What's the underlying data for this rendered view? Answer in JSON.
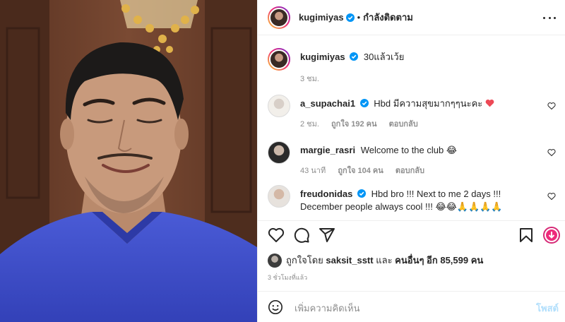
{
  "post": {
    "author": "kugimiyas",
    "follow_status": "กำลังติดตาม",
    "caption": "30แล้วเว้ย",
    "caption_time": "3 ชม."
  },
  "comments": [
    {
      "user": "a_supachai1",
      "text": "Hbd มีความสุขมากๆๆนะคะ",
      "time": "2 ชม.",
      "likes": "ถูกใจ 192 คน",
      "reply": "ตอบกลับ"
    },
    {
      "user": "margie_rasri",
      "text": "Welcome to the club 😂",
      "time": "43 นาที",
      "likes": "ถูกใจ 104 คน",
      "reply": "ตอบกลับ"
    },
    {
      "user": "freudonidas",
      "text": "Hbd bro !!! Next to me 2 days !!! December people always cool !!! 😂😂🙏🙏🙏🙏"
    }
  ],
  "likes": {
    "prefix": "ถูกใจโดย",
    "user": "saksit_sstt",
    "middle": "และ",
    "others": "คนอื่นๆ อีก 85,599 คน"
  },
  "post_time": "3 ชั่วโมงที่แล้ว",
  "composer": {
    "placeholder": "เพิ่มความคิดเห็น",
    "post_label": "โพสต์"
  },
  "colors": {
    "verified": "#0095f6",
    "heart": "#ed4956",
    "post_disabled": "#b2dffc",
    "muted": "#8e8e8e"
  },
  "icons": [
    "more-icon",
    "verified-icon",
    "heart-icon",
    "comment-icon",
    "share-icon",
    "bookmark-icon",
    "emoji-icon"
  ]
}
